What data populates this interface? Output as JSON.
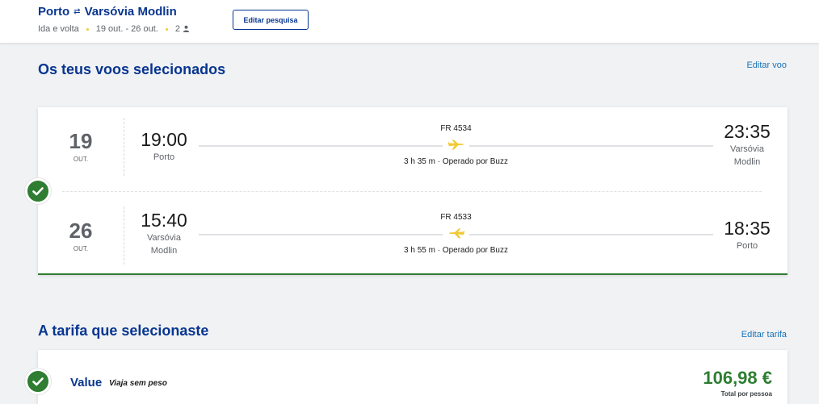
{
  "header": {
    "origin": "Porto",
    "route_icon": "round-trip-arrows-icon",
    "destination": "Varsóvia Modlin",
    "trip_type": "Ida e volta",
    "dates": "19 out. - 26 out.",
    "passengers": "2",
    "edit_search_label": "Editar pesquisa"
  },
  "selected_flights": {
    "title": "Os teus voos selecionados",
    "edit_label": "Editar voo",
    "legs": [
      {
        "day": "19",
        "month": "OUT.",
        "departure_time": "19:00",
        "departure_city": "Porto",
        "flight_number": "FR 4534",
        "duration": "3 h 35 m · Operado por Buzz",
        "arrival_time": "23:35",
        "arrival_city": "Varsóvia Modlin"
      },
      {
        "day": "26",
        "month": "OUT.",
        "departure_time": "15:40",
        "departure_city": "Varsóvia Modlin",
        "flight_number": "FR 4533",
        "duration": "3 h 55 m · Operado por Buzz",
        "arrival_time": "18:35",
        "arrival_city": "Porto"
      }
    ]
  },
  "fare": {
    "title": "A tarifa que selecionaste",
    "edit_label": "Editar tarifa",
    "name": "Value",
    "description": "Viaja sem peso",
    "price": "106,98 €",
    "price_label": "Total por pessoa"
  },
  "colors": {
    "brand_blue": "#073590",
    "success_green": "#2e7d32",
    "accent_yellow": "#f1c933"
  }
}
